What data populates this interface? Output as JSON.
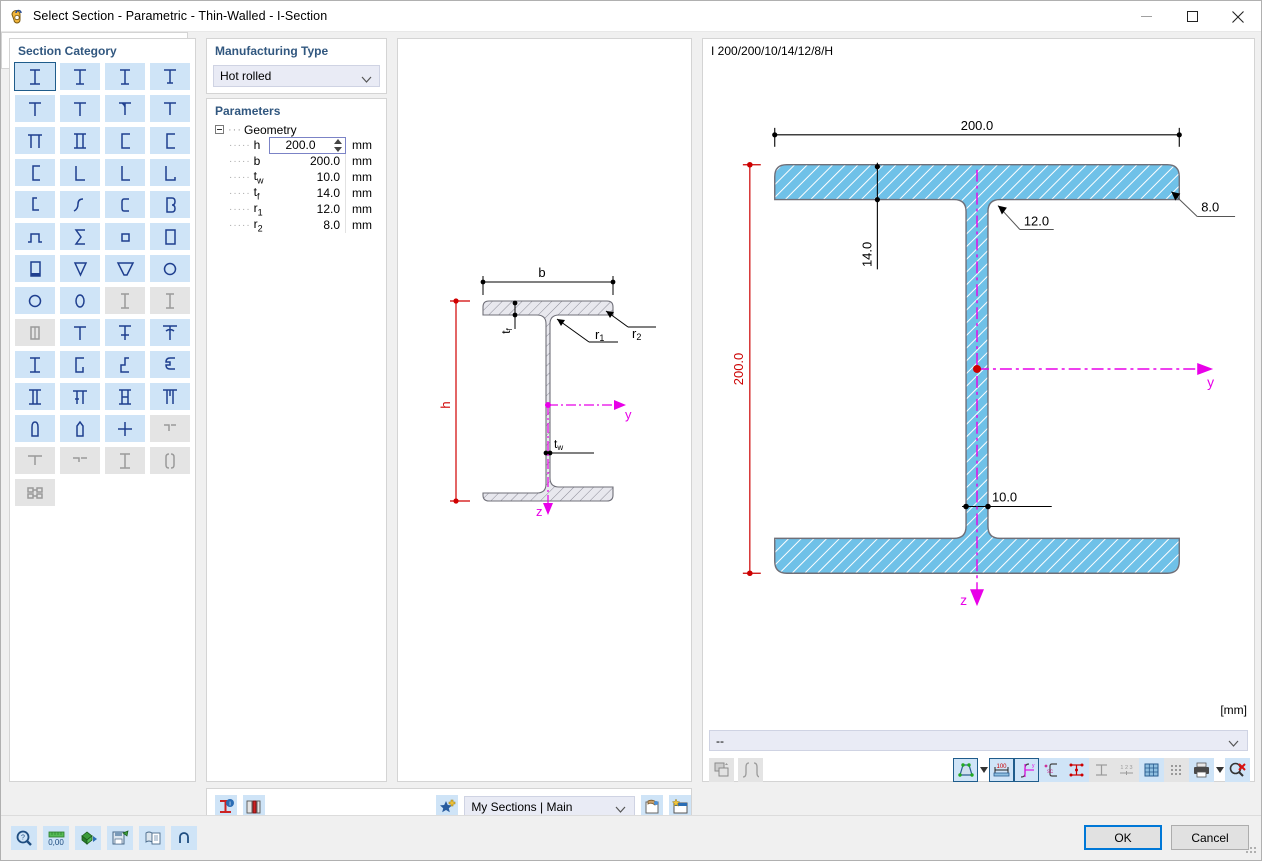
{
  "window": {
    "title": "Select Section - Parametric - Thin-Walled - I-Section",
    "icon": "section-icon",
    "minimize": "minimize-icon",
    "maximize": "maximize-icon",
    "close": "close-icon"
  },
  "section_category": {
    "heading": "Section Category",
    "selected_index": 0,
    "items": [
      {
        "name": "i-section",
        "glyph": "I",
        "enabled": true
      },
      {
        "name": "i-section-unequal",
        "glyph": "I2",
        "enabled": true
      },
      {
        "name": "i-section-welded",
        "glyph": "I3",
        "enabled": true
      },
      {
        "name": "i-section-tapered",
        "glyph": "I4",
        "enabled": true
      },
      {
        "name": "t-section",
        "glyph": "T1",
        "enabled": true
      },
      {
        "name": "t-section-2",
        "glyph": "T2",
        "enabled": true
      },
      {
        "name": "t-section-3",
        "glyph": "T3",
        "enabled": true
      },
      {
        "name": "t-section-4",
        "glyph": "T4",
        "enabled": true
      },
      {
        "name": "double-u-section",
        "glyph": "PI",
        "enabled": true
      },
      {
        "name": "double-i-section",
        "glyph": "II",
        "enabled": true
      },
      {
        "name": "channel-section",
        "glyph": "C1",
        "enabled": true
      },
      {
        "name": "channel-section-2",
        "glyph": "C2",
        "enabled": true
      },
      {
        "name": "channel-section-3",
        "glyph": "C3",
        "enabled": true
      },
      {
        "name": "angle-section",
        "glyph": "L1",
        "enabled": true
      },
      {
        "name": "angle-section-2",
        "glyph": "L2",
        "enabled": true
      },
      {
        "name": "angle-section-3",
        "glyph": "L3",
        "enabled": true
      },
      {
        "name": "z-section",
        "glyph": "Z1",
        "enabled": true
      },
      {
        "name": "z-section-2",
        "glyph": "Z2",
        "enabled": true
      },
      {
        "name": "c-section",
        "glyph": "CC",
        "enabled": true
      },
      {
        "name": "sigma-section-b",
        "glyph": "B",
        "enabled": true
      },
      {
        "name": "hat-section",
        "glyph": "HAT",
        "enabled": true
      },
      {
        "name": "sigma-section",
        "glyph": "SIG",
        "enabled": true
      },
      {
        "name": "square-hollow",
        "glyph": "SQ",
        "enabled": true
      },
      {
        "name": "rect-hollow",
        "glyph": "RECT",
        "enabled": true
      },
      {
        "name": "rect-hollow-filled",
        "glyph": "RECTF",
        "enabled": true
      },
      {
        "name": "trapezoid-section",
        "glyph": "TRAP1",
        "enabled": true
      },
      {
        "name": "trapezoid-section-2",
        "glyph": "TRAP2",
        "enabled": true
      },
      {
        "name": "circular-hollow",
        "glyph": "CIRC",
        "enabled": true
      },
      {
        "name": "circle-section",
        "glyph": "O1",
        "enabled": true
      },
      {
        "name": "oval-section",
        "glyph": "O2",
        "enabled": true
      },
      {
        "name": "i-variant-1",
        "glyph": "IV1",
        "enabled": false
      },
      {
        "name": "i-variant-2",
        "glyph": "IV2",
        "enabled": false
      },
      {
        "name": "double-rect",
        "glyph": "DR",
        "enabled": false
      },
      {
        "name": "t-variant-1",
        "glyph": "TV1",
        "enabled": true
      },
      {
        "name": "t-variant-2",
        "glyph": "TV2",
        "enabled": true
      },
      {
        "name": "t-variant-3",
        "glyph": "TV3",
        "enabled": true
      },
      {
        "name": "i-variant-3",
        "glyph": "IV3",
        "enabled": true
      },
      {
        "name": "c-variant-1",
        "glyph": "CV1",
        "enabled": true
      },
      {
        "name": "c-variant-2",
        "glyph": "CV2",
        "enabled": true
      },
      {
        "name": "c-variant-3",
        "glyph": "CV3",
        "enabled": true
      },
      {
        "name": "double-i-1",
        "glyph": "DI1",
        "enabled": true
      },
      {
        "name": "double-t-1",
        "glyph": "DT1",
        "enabled": true
      },
      {
        "name": "double-i-2",
        "glyph": "DI2",
        "enabled": true
      },
      {
        "name": "double-t-2",
        "glyph": "DT2",
        "enabled": true
      },
      {
        "name": "bullet-section",
        "glyph": "BUL",
        "enabled": true
      },
      {
        "name": "pentagon-section",
        "glyph": "PEN",
        "enabled": true
      },
      {
        "name": "cross-section",
        "glyph": "PLUS",
        "enabled": true
      },
      {
        "name": "tt-variant-1",
        "glyph": "TT1",
        "enabled": false
      },
      {
        "name": "tt-variant-2",
        "glyph": "TT2",
        "enabled": false
      },
      {
        "name": "tt-variant-3",
        "glyph": "TT3",
        "enabled": false
      },
      {
        "name": "i-variant-4",
        "glyph": "IV4",
        "enabled": false
      },
      {
        "name": "cc-variant",
        "glyph": "CCV",
        "enabled": false
      },
      {
        "name": "double-box",
        "glyph": "DB",
        "enabled": false
      }
    ]
  },
  "manufacturing": {
    "heading": "Manufacturing Type",
    "selected": "Hot rolled",
    "options": [
      "Hot rolled"
    ]
  },
  "parameters": {
    "heading": "Parameters",
    "group": "Geometry",
    "active_row": 0,
    "rows": [
      {
        "name": "h",
        "sub": "",
        "value": "200.0",
        "unit": "mm"
      },
      {
        "name": "b",
        "sub": "",
        "value": "200.0",
        "unit": "mm"
      },
      {
        "name": "t",
        "sub": "w",
        "value": "10.0",
        "unit": "mm"
      },
      {
        "name": "t",
        "sub": "f",
        "value": "14.0",
        "unit": "mm"
      },
      {
        "name": "r",
        "sub": "1",
        "value": "12.0",
        "unit": "mm"
      },
      {
        "name": "r",
        "sub": "2",
        "value": "8.0",
        "unit": "mm"
      }
    ]
  },
  "schematic": {
    "labels": {
      "b": "b",
      "h": "h",
      "tf": "t",
      "tf_sub": "f",
      "tw": "t",
      "tw_sub": "w",
      "r1": "r",
      "r1_sub": "1",
      "r2": "r",
      "r2_sub": "2",
      "y": "y",
      "z": "z"
    }
  },
  "preview": {
    "section_name": "I 200/200/10/14/12/8/H",
    "unit_label": "[mm]",
    "selection_combo": "--",
    "dimensions": {
      "width_top": "200.0",
      "height_left": "200.0",
      "flange_thickness": "14.0",
      "web_thickness": "10.0",
      "radius_r1": "12.0",
      "radius_r2": "8.0",
      "axis_y": "y",
      "axis_z": "z"
    },
    "toolbar": [
      {
        "name": "render-mode-button",
        "icon": "shape-render-icon",
        "state": "framed"
      },
      {
        "name": "render-mode-dropdown",
        "icon": "chevron-down-icon",
        "state": "caret"
      },
      {
        "name": "show-dimensions-button",
        "icon": "dimension-icon",
        "state": "framed"
      },
      {
        "name": "show-axes-button",
        "icon": "axis-system-icon",
        "state": "framed"
      },
      {
        "name": "shear-center-button",
        "icon": "shear-center-icon",
        "state": "lit"
      },
      {
        "name": "show-stress-points-button",
        "icon": "stress-points-icon",
        "state": "lit"
      },
      {
        "name": "show-section-outline-button",
        "icon": "section-outline-icon",
        "state": "off"
      },
      {
        "name": "numbering-button",
        "icon": "numbering-icon",
        "state": "off"
      },
      {
        "name": "grid-button",
        "icon": "grid-icon",
        "state": "lit"
      },
      {
        "name": "snap-button",
        "icon": "snap-grid-icon",
        "state": "off"
      },
      {
        "name": "print-button",
        "icon": "printer-icon",
        "state": "lit"
      },
      {
        "name": "print-dropdown",
        "icon": "chevron-down-icon",
        "state": "caret"
      },
      {
        "name": "zoom-reset-button",
        "icon": "zoom-delete-icon",
        "state": "lit"
      }
    ]
  },
  "small_panel": {
    "buttons": [
      {
        "name": "section-bounds-button",
        "icon": "dashed-box-icon"
      },
      {
        "name": "section-slot-button",
        "icon": "dashed-slot-icon"
      }
    ]
  },
  "library_bar": {
    "buttons_left": [
      {
        "name": "section-info-button",
        "icon": "section-info-icon"
      },
      {
        "name": "library-book-button",
        "icon": "library-book-icon"
      }
    ],
    "favorite_button": {
      "name": "add-favorite-button",
      "icon": "star-plus-icon"
    },
    "combo_value": "My Sections | Main",
    "buttons_right": [
      {
        "name": "import-section-button",
        "icon": "import-icon"
      },
      {
        "name": "new-section-button",
        "icon": "new-document-icon"
      }
    ]
  },
  "footer": {
    "tools": [
      {
        "name": "search-button",
        "icon": "magnifier-icon"
      },
      {
        "name": "units-button",
        "icon": "units-ruler-icon"
      },
      {
        "name": "export-button",
        "icon": "export-arrow-icon"
      },
      {
        "name": "save-button",
        "icon": "save-icon"
      },
      {
        "name": "report-button",
        "icon": "report-icon"
      },
      {
        "name": "undo-button",
        "icon": "undo-arrow-icon"
      }
    ],
    "ok_label": "OK",
    "cancel_label": "Cancel"
  },
  "colors": {
    "accent_blue": "#0078d7",
    "panel_heading": "#31577f",
    "icon_blue": "#1f3f8f",
    "cell_blue": "#cfe4f7",
    "steel_fill": "#6fc1e8",
    "dim_red": "#d00000",
    "axis_magenta": "#e800e8"
  }
}
